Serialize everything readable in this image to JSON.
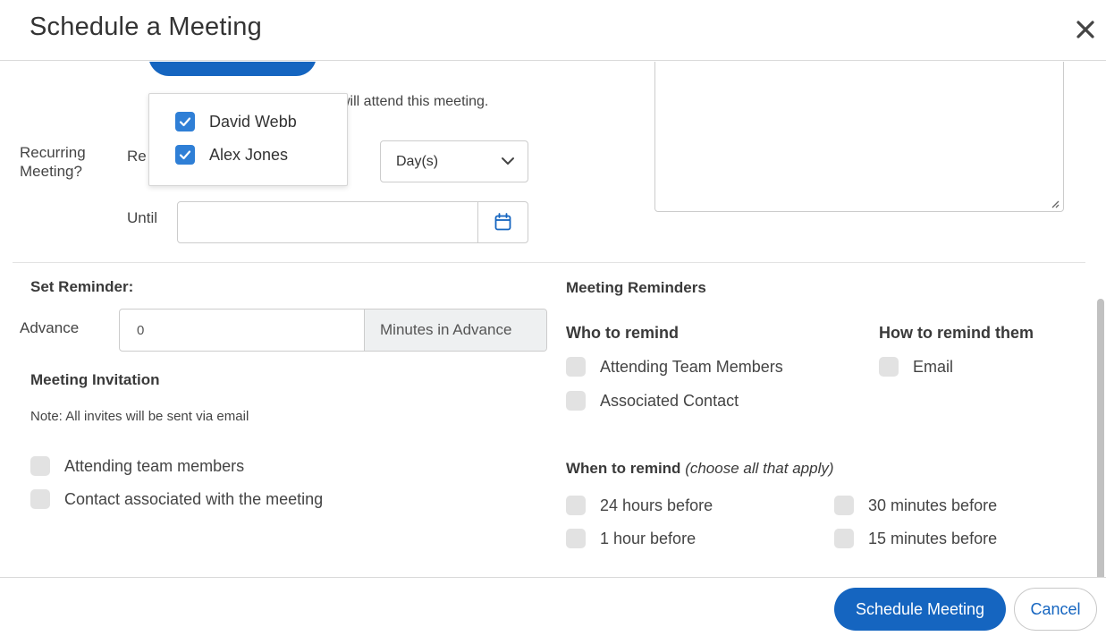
{
  "dialog": {
    "title": "Schedule a Meeting",
    "close_icon": "close-icon"
  },
  "team_popup": {
    "members": [
      {
        "name": "David Webb",
        "checked": true
      },
      {
        "name": "Alex Jones",
        "checked": true
      }
    ]
  },
  "recurrence": {
    "hint_text": "will attend this meeting.",
    "recurring_label": "Recurring Meeting?",
    "repeat_label_partial": "Re",
    "unit_select": {
      "value": "Day(s)"
    },
    "until_label": "Until",
    "until_value": "",
    "calendar_icon": "calendar-icon"
  },
  "set_reminder": {
    "heading": "Set Reminder:",
    "advance_label": "Advance",
    "advance_value": "0",
    "advance_suffix": "Minutes in Advance"
  },
  "meeting_invitation": {
    "heading": "Meeting Invitation",
    "note": "Note: All invites will be sent via email",
    "options": [
      {
        "label": "Attending team members",
        "checked": false
      },
      {
        "label": "Contact associated with the meeting",
        "checked": false
      }
    ]
  },
  "meeting_reminders": {
    "heading": "Meeting Reminders",
    "who_heading": "Who to remind",
    "who_options": [
      {
        "label": "Attending Team Members",
        "checked": false
      },
      {
        "label": "Associated Contact",
        "checked": false
      }
    ],
    "how_heading": "How to remind them",
    "how_options": [
      {
        "label": "Email",
        "checked": false
      }
    ],
    "when_heading": "When to remind",
    "when_note": "(choose all that apply)",
    "when_options": [
      {
        "label": "24 hours before",
        "checked": false
      },
      {
        "label": "30 minutes before",
        "checked": false
      },
      {
        "label": "1 hour before",
        "checked": false
      },
      {
        "label": "15 minutes before",
        "checked": false
      }
    ]
  },
  "footer": {
    "primary_label": "Schedule Meeting",
    "cancel_label": "Cancel"
  },
  "colors": {
    "primary": "#1565c0",
    "checkbox_checked": "#2f7fd6",
    "checkbox_unchecked": "#e2e2e2"
  }
}
